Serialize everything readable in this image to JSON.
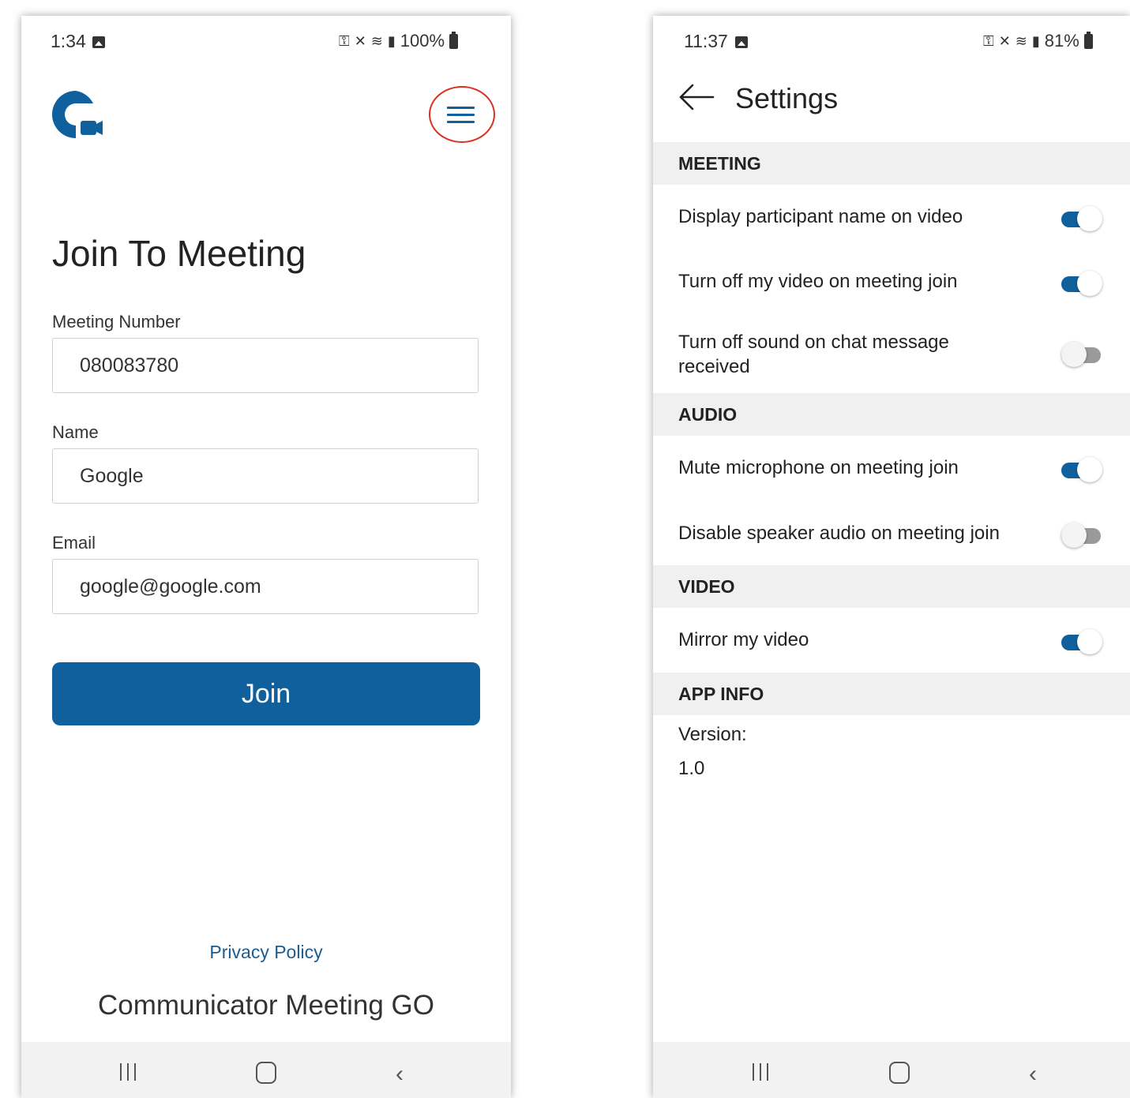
{
  "left": {
    "status": {
      "time": "1:34",
      "battery": "100%"
    },
    "title": "Join To Meeting",
    "fields": {
      "meeting_number": {
        "label": "Meeting Number",
        "value": "080083780"
      },
      "name": {
        "label": "Name",
        "value": "Google"
      },
      "email": {
        "label": "Email",
        "value": "google@google.com"
      }
    },
    "join_label": "Join",
    "privacy_label": "Privacy Policy",
    "app_name": "Communicator Meeting GO",
    "brand_color": "#10609e",
    "highlight_color": "#d9321f"
  },
  "right": {
    "status": {
      "time": "11:37",
      "battery": "81%"
    },
    "title": "Settings",
    "sections": {
      "meeting": "MEETING",
      "audio": "AUDIO",
      "video": "VIDEO",
      "app_info": "APP INFO"
    },
    "settings": {
      "display_name": {
        "label": "Display participant name on video",
        "enabled": true
      },
      "video_off": {
        "label": "Turn off my video on meeting join",
        "enabled": true
      },
      "chat_sound": {
        "label": "Turn off sound on chat message received",
        "enabled": false
      },
      "mute_mic": {
        "label": "Mute microphone on meeting join",
        "enabled": true
      },
      "speaker": {
        "label": "Disable speaker audio on meeting join",
        "enabled": false
      },
      "mirror": {
        "label": "Mirror my video",
        "enabled": true
      }
    },
    "version_label": "Version:",
    "version_value": "1.0"
  }
}
